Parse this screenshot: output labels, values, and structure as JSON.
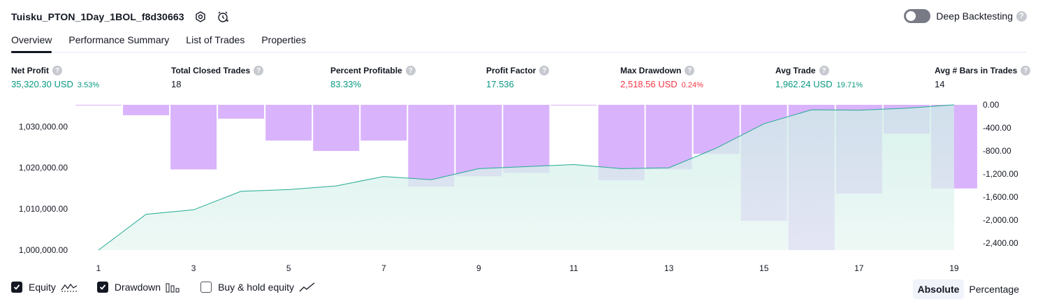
{
  "header": {
    "strategy_name": "Tuisku_PTON_1Day_1BOL_f8d30663",
    "settings_icon": "settings-icon",
    "alert_icon": "alarm-clock-icon",
    "deep_backtesting_label": "Deep Backtesting",
    "deep_backtesting_enabled": false,
    "help_glyph": "?"
  },
  "tabs": [
    {
      "label": "Overview",
      "active": true
    },
    {
      "label": "Performance Summary",
      "active": false
    },
    {
      "label": "List of Trades",
      "active": false
    },
    {
      "label": "Properties",
      "active": false
    }
  ],
  "metrics": [
    {
      "label": "Net Profit",
      "value": "35,320.30 USD",
      "pct": "3.53%",
      "tone": "pos"
    },
    {
      "label": "Total Closed Trades",
      "value": "18",
      "pct": "",
      "tone": "neu"
    },
    {
      "label": "Percent Profitable",
      "value": "83.33%",
      "pct": "",
      "tone": "pos"
    },
    {
      "label": "Profit Factor",
      "value": "17.536",
      "pct": "",
      "tone": "pos"
    },
    {
      "label": "Max Drawdown",
      "value": "2,518.56 USD",
      "pct": "0.24%",
      "tone": "neg"
    },
    {
      "label": "Avg Trade",
      "value": "1,962.24 USD",
      "pct": "19.71%",
      "tone": "pos"
    },
    {
      "label": "Avg # Bars in Trades",
      "value": "14",
      "pct": "",
      "tone": "neu"
    }
  ],
  "colors": {
    "equity_line": "#22ab94",
    "equity_fill_top": "#cdeee6",
    "equity_fill_bottom": "#e8f6f2",
    "drawdown_bar": "#d9b3fb",
    "positive": "#089981",
    "negative": "#f23645"
  },
  "chart_data": {
    "type": "bar",
    "x_ticks": [
      "1",
      "3",
      "5",
      "7",
      "9",
      "11",
      "13",
      "15",
      "17",
      "19"
    ],
    "equity": {
      "x": [
        1,
        2,
        3,
        4,
        5,
        6,
        7,
        8,
        9,
        10,
        11,
        12,
        13,
        14,
        15,
        16,
        17,
        18,
        19
      ],
      "values": [
        1000000,
        1008700,
        1009800,
        1014300,
        1014700,
        1015600,
        1017900,
        1017100,
        1019800,
        1020300,
        1020800,
        1019800,
        1020000,
        1024800,
        1030700,
        1034100,
        1034000,
        1034500,
        1035320
      ]
    },
    "drawdown": {
      "x": [
        1,
        2,
        3,
        4,
        5,
        6,
        7,
        8,
        9,
        10,
        11,
        12,
        13,
        14,
        15,
        16,
        17,
        18,
        19
      ],
      "values": [
        -10,
        -180,
        -1120,
        -240,
        -620,
        -800,
        -620,
        -1420,
        -1240,
        -1180,
        0,
        -1310,
        -1120,
        -850,
        -2010,
        -2519,
        -1540,
        -500,
        -1450
      ]
    },
    "y_left_ticks": [
      "1,000,000.00",
      "1,010,000.00",
      "1,020,000.00",
      "1,030,000.00"
    ],
    "y_left_range": [
      1000000,
      1035320
    ],
    "y_right_ticks": [
      "0.00",
      "-400.00",
      "-800.00",
      "-1,200.00",
      "-1,600.00",
      "-2,000.00",
      "-2,400.00"
    ],
    "y_right_range": [
      -2519,
      0
    ]
  },
  "legend": [
    {
      "label": "Equity",
      "checked": true,
      "icon": "equity-line-icon"
    },
    {
      "label": "Drawdown",
      "checked": true,
      "icon": "drawdown-bars-icon"
    },
    {
      "label": "Buy & hold equity",
      "checked": false,
      "icon": "buy-hold-line-icon"
    }
  ],
  "mode": {
    "absolute_label": "Absolute",
    "percentage_label": "Percentage",
    "active": "absolute"
  }
}
